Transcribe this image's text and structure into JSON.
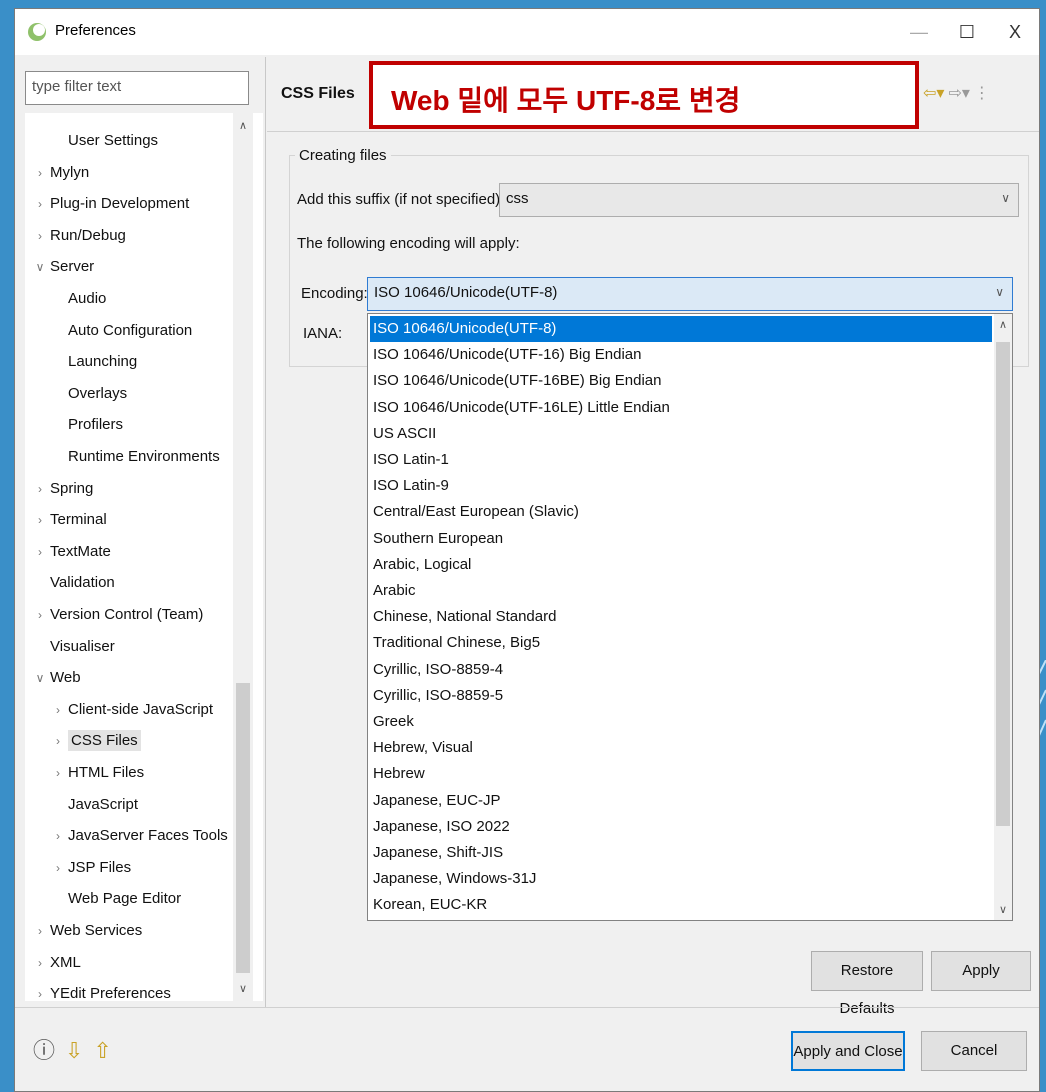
{
  "window": {
    "title": "Preferences",
    "minimize": "—",
    "maximize": "☐",
    "close": "X"
  },
  "filter": {
    "placeholder": "type filter text"
  },
  "tree": {
    "items": [
      {
        "label": "User Settings",
        "indent": 1,
        "arrow": ""
      },
      {
        "label": "Mylyn",
        "indent": 0,
        "arrow": "›"
      },
      {
        "label": "Plug-in Development",
        "indent": 0,
        "arrow": "›"
      },
      {
        "label": "Run/Debug",
        "indent": 0,
        "arrow": "›"
      },
      {
        "label": "Server",
        "indent": 0,
        "arrow": "∨"
      },
      {
        "label": "Audio",
        "indent": 1,
        "arrow": ""
      },
      {
        "label": "Auto Configuration",
        "indent": 1,
        "arrow": ""
      },
      {
        "label": "Launching",
        "indent": 1,
        "arrow": ""
      },
      {
        "label": "Overlays",
        "indent": 1,
        "arrow": ""
      },
      {
        "label": "Profilers",
        "indent": 1,
        "arrow": ""
      },
      {
        "label": "Runtime Environments",
        "indent": 1,
        "arrow": ""
      },
      {
        "label": "Spring",
        "indent": 0,
        "arrow": "›"
      },
      {
        "label": "Terminal",
        "indent": 0,
        "arrow": "›"
      },
      {
        "label": "TextMate",
        "indent": 0,
        "arrow": "›"
      },
      {
        "label": "Validation",
        "indent": 0,
        "arrow": ""
      },
      {
        "label": "Version Control (Team)",
        "indent": 0,
        "arrow": "›"
      },
      {
        "label": "Visualiser",
        "indent": 0,
        "arrow": ""
      },
      {
        "label": "Web",
        "indent": 0,
        "arrow": "∨"
      },
      {
        "label": "Client-side JavaScript",
        "indent": 1,
        "arrow": "›"
      },
      {
        "label": "CSS Files",
        "indent": 1,
        "arrow": "›",
        "selected": true
      },
      {
        "label": "HTML Files",
        "indent": 1,
        "arrow": "›"
      },
      {
        "label": "JavaScript",
        "indent": 1,
        "arrow": ""
      },
      {
        "label": "JavaServer Faces Tools",
        "indent": 1,
        "arrow": "›"
      },
      {
        "label": "JSP Files",
        "indent": 1,
        "arrow": "›"
      },
      {
        "label": "Web Page Editor",
        "indent": 1,
        "arrow": ""
      },
      {
        "label": "Web Services",
        "indent": 0,
        "arrow": "›"
      },
      {
        "label": "XML",
        "indent": 0,
        "arrow": "›"
      },
      {
        "label": "YEdit Preferences",
        "indent": 0,
        "arrow": "›"
      }
    ]
  },
  "page": {
    "title": "CSS Files",
    "annotation": "Web 밑에 모두 UTF-8로 변경",
    "group_title": "Creating files",
    "suffix_label": "Add this suffix (if not specified):",
    "suffix_value": "css",
    "encoding_note": "The following encoding will apply:",
    "encoding_label": "Encoding:",
    "encoding_value": "ISO 10646/Unicode(UTF-8)",
    "iana_label": "IANA:"
  },
  "dropdown": {
    "options": [
      "ISO 10646/Unicode(UTF-8)",
      "ISO 10646/Unicode(UTF-16) Big Endian",
      "ISO 10646/Unicode(UTF-16BE) Big Endian",
      "ISO 10646/Unicode(UTF-16LE) Little Endian",
      "US ASCII",
      "ISO Latin-1",
      "ISO Latin-9",
      "Central/East European (Slavic)",
      "Southern European",
      "Arabic, Logical",
      "Arabic",
      "Chinese, National Standard",
      "Traditional Chinese, Big5",
      "Cyrillic, ISO-8859-4",
      "Cyrillic, ISO-8859-5",
      "Greek",
      "Hebrew, Visual",
      "Hebrew",
      "Japanese, EUC-JP",
      "Japanese, ISO 2022",
      "Japanese, Shift-JIS",
      "Japanese, Windows-31J",
      "Korean, EUC-KR"
    ],
    "selected_index": 0
  },
  "buttons": {
    "restore_defaults": "Restore Defaults",
    "apply": "Apply",
    "apply_and_close": "Apply and Close",
    "cancel": "Cancel"
  },
  "colors": {
    "selection": "#0078d7",
    "annotation": "#c00000",
    "background": "#3a8fc8"
  }
}
